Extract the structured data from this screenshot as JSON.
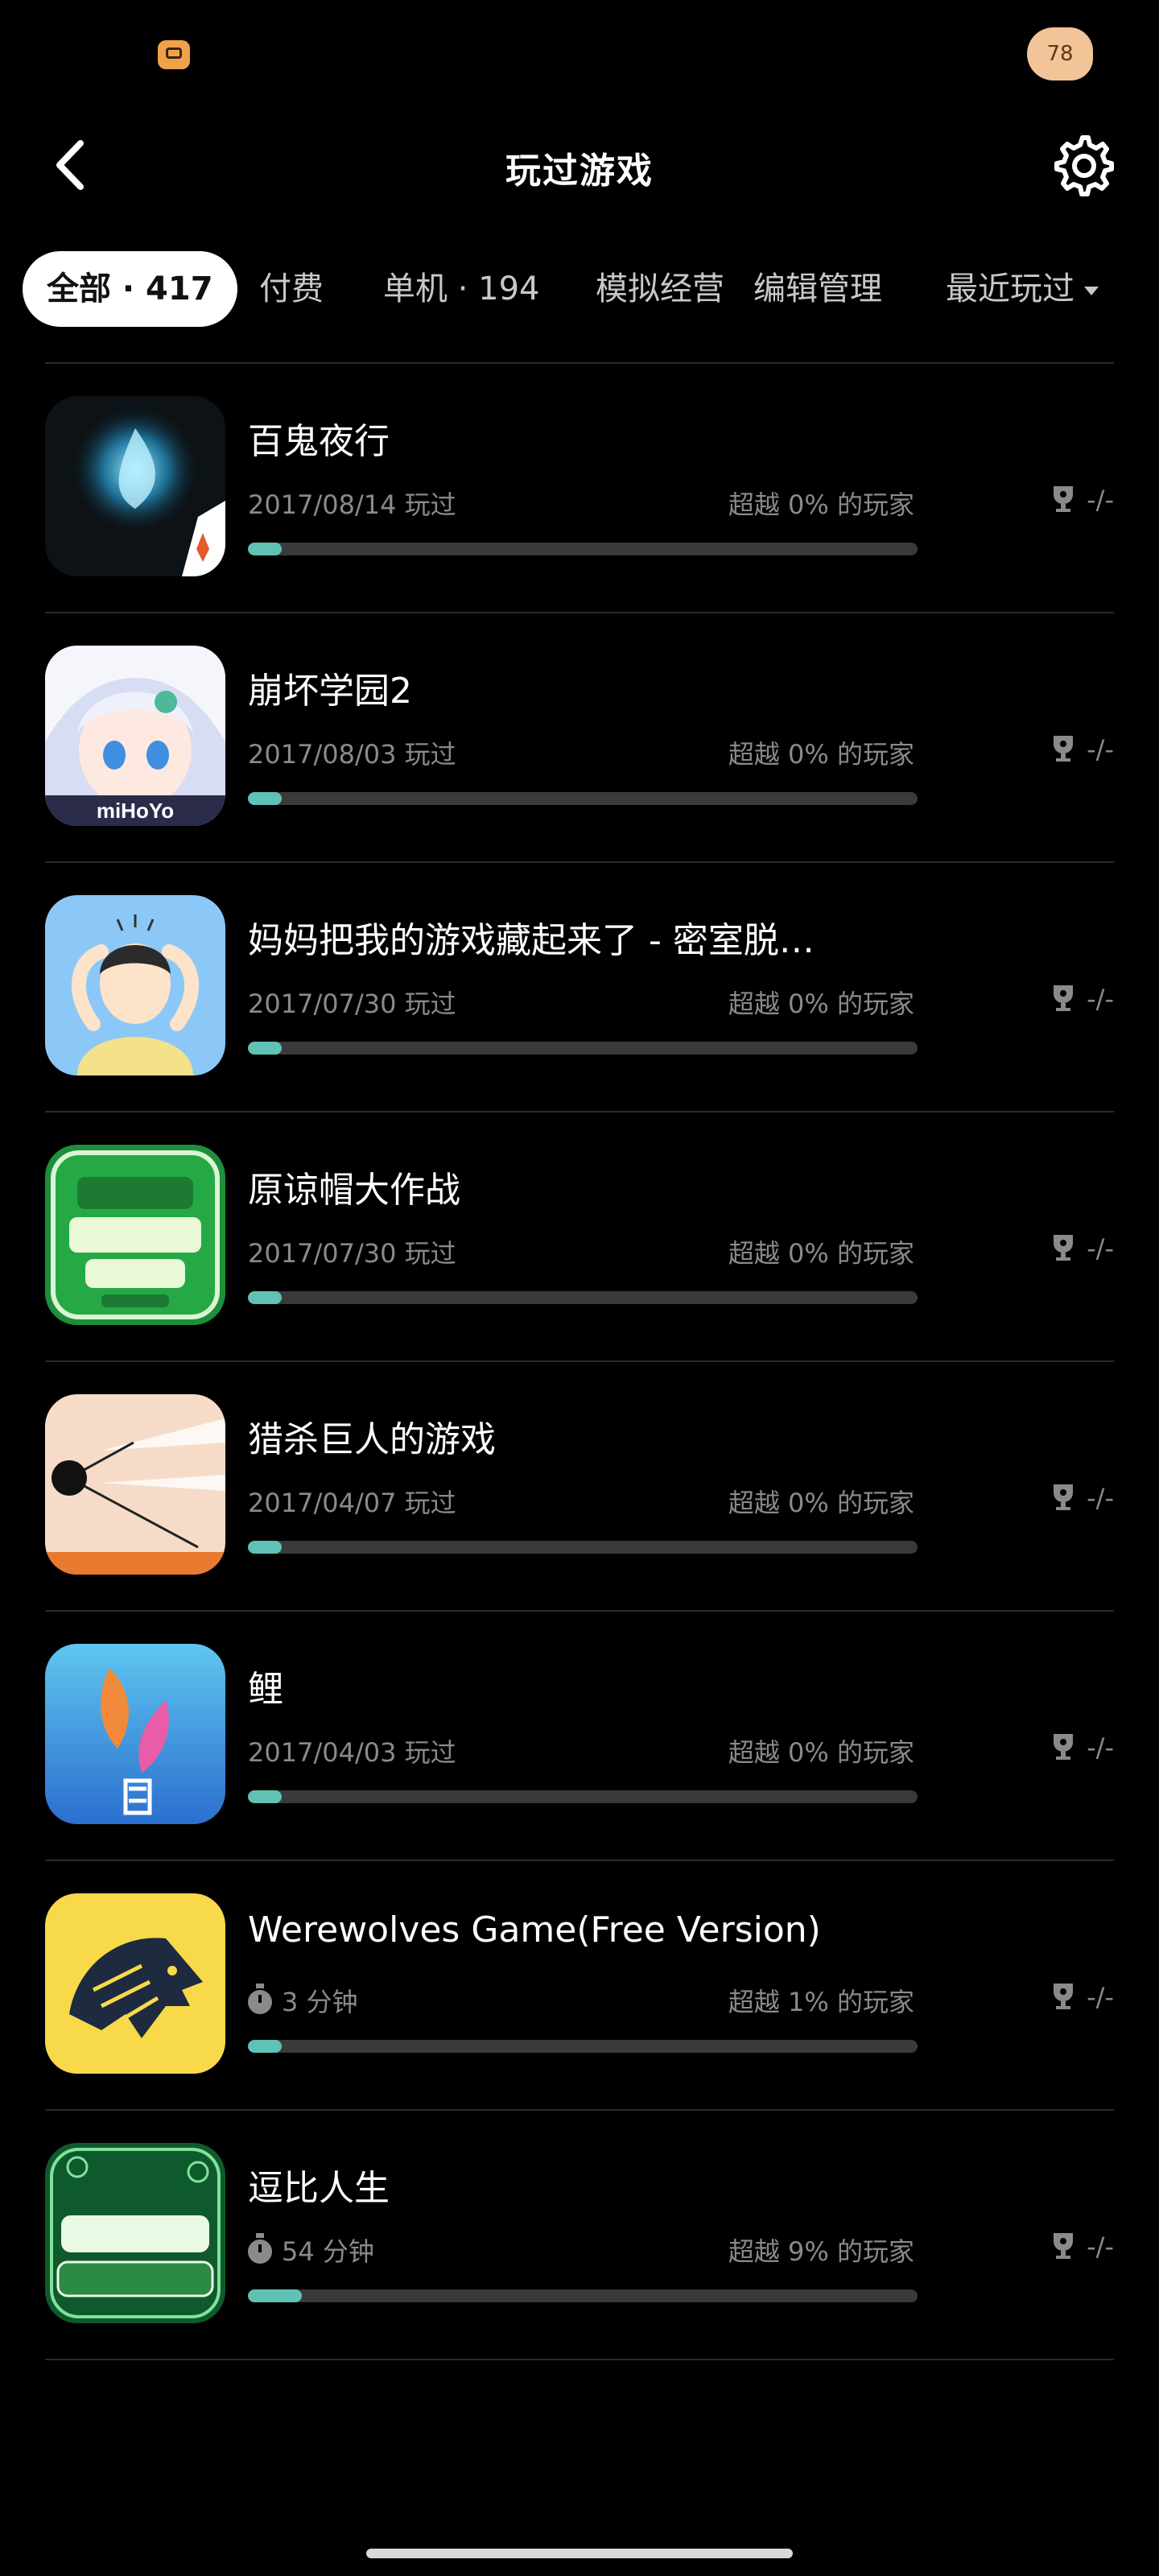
{
  "status": {
    "badge_text": "78"
  },
  "header": {
    "title": "玩过游戏"
  },
  "tabs": [
    {
      "label": "全部 · 417",
      "active": true
    },
    {
      "label": "付费",
      "active": false
    },
    {
      "label": "单机 · 194",
      "active": false
    },
    {
      "label": "模拟经营",
      "active": false
    },
    {
      "label": "编辑管理",
      "active": false
    }
  ],
  "sort": {
    "label": "最近玩过"
  },
  "games": [
    {
      "name": "百鬼夜行",
      "meta": "2017/08/14 玩过",
      "rank": "超越 0% 的玩家",
      "trophy": "-/-",
      "progress": 0.05,
      "timer": false
    },
    {
      "name": "崩坏学园2",
      "meta": "2017/08/03 玩过",
      "rank": "超越 0% 的玩家",
      "trophy": "-/-",
      "progress": 0.05,
      "timer": false
    },
    {
      "name": "妈妈把我的游戏藏起来了 - 密室脱…",
      "meta": "2017/07/30 玩过",
      "rank": "超越 0% 的玩家",
      "trophy": "-/-",
      "progress": 0.05,
      "timer": false
    },
    {
      "name": "原谅帽大作战",
      "meta": "2017/07/30 玩过",
      "rank": "超越 0% 的玩家",
      "trophy": "-/-",
      "progress": 0.05,
      "timer": false
    },
    {
      "name": "猎杀巨人的游戏",
      "meta": "2017/04/07 玩过",
      "rank": "超越 0% 的玩家",
      "trophy": "-/-",
      "progress": 0.05,
      "timer": false
    },
    {
      "name": "鲤",
      "meta": "2017/04/03 玩过",
      "rank": "超越 0% 的玩家",
      "trophy": "-/-",
      "progress": 0.05,
      "timer": false
    },
    {
      "name": "Werewolves Game(Free Version)",
      "meta": "3 分钟",
      "rank": "超越 1% 的玩家",
      "trophy": "-/-",
      "progress": 0.05,
      "timer": true
    },
    {
      "name": "逗比人生",
      "meta": "54 分钟",
      "rank": "超越 9% 的玩家",
      "trophy": "-/-",
      "progress": 0.08,
      "timer": true
    }
  ],
  "icons": {
    "back": "chevron-left-icon",
    "settings": "gear-icon",
    "sort": "caret-down-icon",
    "trophy": "trophy-icon",
    "timer": "stopwatch-icon"
  },
  "colors": {
    "accent": "#5fc2b5",
    "background": "#000000"
  }
}
